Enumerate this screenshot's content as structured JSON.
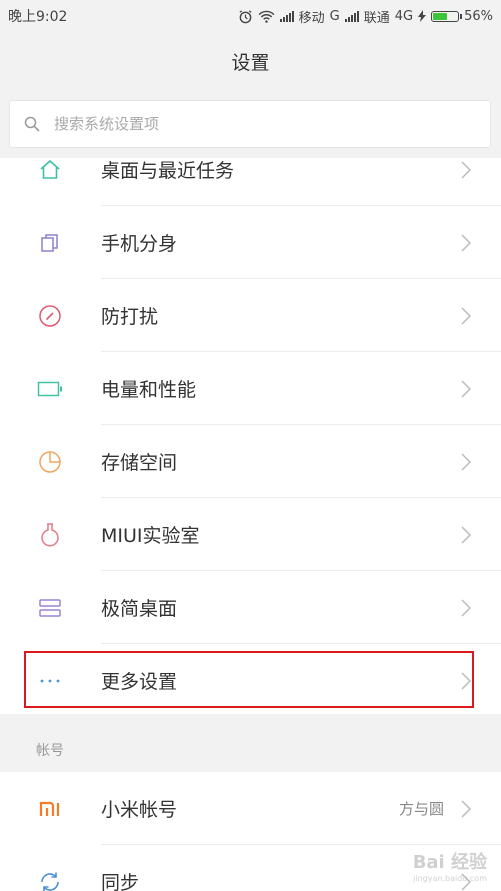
{
  "status_bar": {
    "time": "晚上9:02",
    "carrier1": "移动",
    "network1": "G",
    "carrier2": "联通",
    "network2": "4G",
    "battery": "56%",
    "battery_level": 0.56
  },
  "header": {
    "title": "设置"
  },
  "search": {
    "placeholder": "搜索系统设置项"
  },
  "settings": [
    {
      "label": "桌面与最近任务",
      "icon": "home-icon",
      "color": "#3cbfa4"
    },
    {
      "label": "手机分身",
      "icon": "dual-app-icon",
      "color": "#8f7fd1"
    },
    {
      "label": "防打扰",
      "icon": "do-not-disturb-icon",
      "color": "#e0596f"
    },
    {
      "label": "电量和性能",
      "icon": "battery-icon",
      "color": "#43c2a1"
    },
    {
      "label": "存储空间",
      "icon": "storage-pie-icon",
      "color": "#f0a561"
    },
    {
      "label": "MIUI实验室",
      "icon": "lab-flask-icon",
      "color": "#e87a8a"
    },
    {
      "label": "极简桌面",
      "icon": "simple-desktop-icon",
      "color": "#9c83d6"
    },
    {
      "label": "更多设置",
      "icon": "more-dots-icon",
      "color": "#4a90d9"
    }
  ],
  "account_section": {
    "header": "帐号",
    "items": [
      {
        "label": "小米帐号",
        "value": "方与圆",
        "icon": "mi-logo-icon",
        "color": "#f57b24"
      },
      {
        "label": "同步",
        "icon": "sync-icon",
        "color": "#4a90d9"
      }
    ]
  },
  "watermark": {
    "text": "Bai 经验",
    "sub": "jingyan.baidu.com"
  }
}
